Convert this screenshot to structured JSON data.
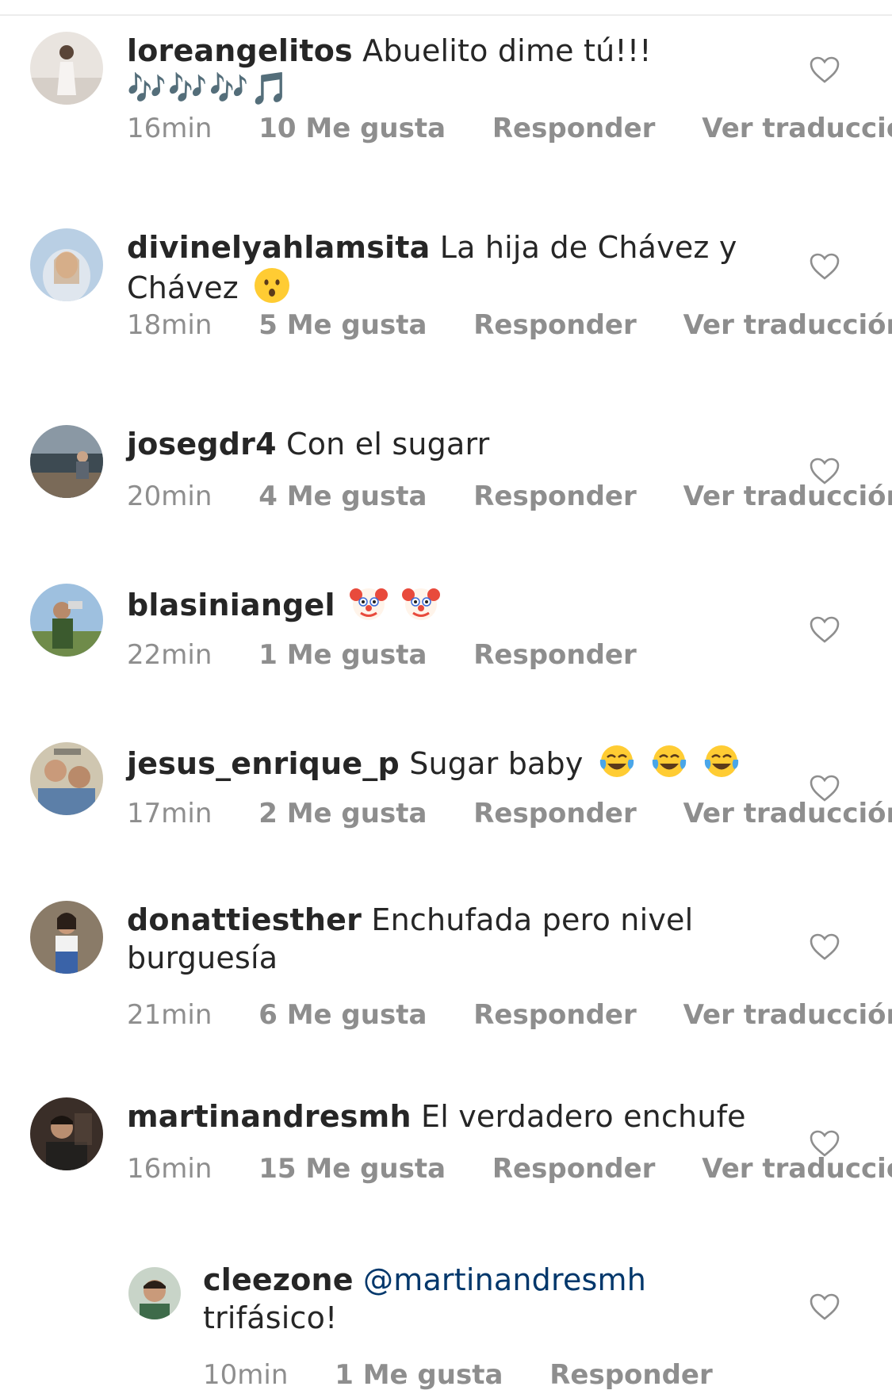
{
  "comments": [
    {
      "username": "loreangelitos",
      "text_line1": "Abuelito dime tú!!!",
      "text_line2": "🎶🎶🎶🎵",
      "time": "16min",
      "likes": "10 Me gusta",
      "reply": "Responder",
      "translate": "Ver traducción"
    },
    {
      "username": "divinelyahlamsita",
      "text_line1": "La hija de Chávez y",
      "text_line2": "Chávez",
      "emoji": "surprised-face",
      "time": "18min",
      "likes": "5 Me gusta",
      "reply": "Responder",
      "translate": "Ver traducción"
    },
    {
      "username": "josegdr4",
      "text_line1": "Con el sugarr",
      "time": "20min",
      "likes": "4 Me gusta",
      "reply": "Responder",
      "translate": "Ver traducción"
    },
    {
      "username": "blasiniangel",
      "emoji": "clown-face",
      "time": "22min",
      "likes": "1 Me gusta",
      "reply": "Responder"
    },
    {
      "username": "jesus_enrique_p",
      "text_line1": "Sugar baby",
      "emoji": "tears-of-joy",
      "time": "17min",
      "likes": "2 Me gusta",
      "reply": "Responder",
      "translate": "Ver traducción"
    },
    {
      "username": "donattiesther",
      "text_line1": "Enchufada pero nivel",
      "text_line2": "burguesía",
      "time": "21min",
      "likes": "6 Me gusta",
      "reply": "Responder",
      "translate": "Ver traducción"
    },
    {
      "username": "martinandresmh",
      "text_line1": "El verdadero enchufe",
      "time": "16min",
      "likes": "15 Me gusta",
      "reply": "Responder",
      "translate": "Ver traducción"
    }
  ],
  "reply": {
    "username": "cleezone",
    "mention": "@martinandresmh",
    "text_line2": "trifásico!",
    "time": "10min",
    "likes": "1 Me gusta",
    "reply": "Responder"
  },
  "icons": {
    "like": "heart-outline-icon"
  },
  "colors": {
    "text": "#262626",
    "meta": "#8e8e8e",
    "mention": "#00376b"
  }
}
